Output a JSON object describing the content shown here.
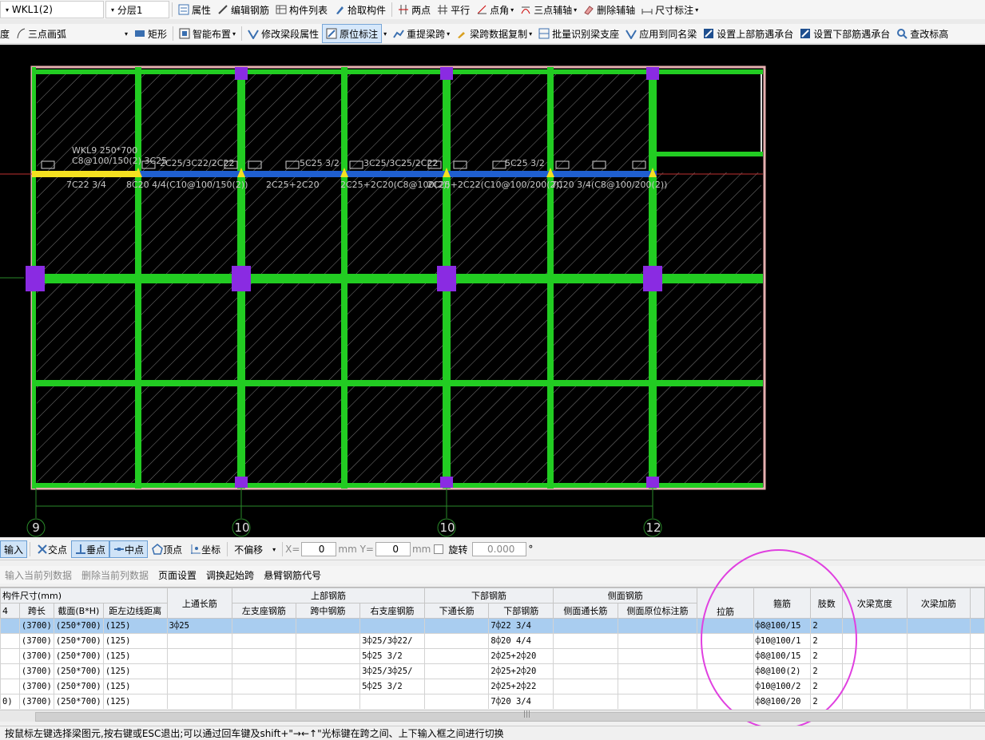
{
  "toolbar1": {
    "component": "WKL1(2)",
    "layer": "分层1",
    "items": [
      "属性",
      "编辑钢筋",
      "构件列表",
      "拾取构件",
      "两点",
      "平行",
      "点角",
      "三点辅轴",
      "删除辅轴",
      "尺寸标注"
    ]
  },
  "toolbar2": {
    "items": [
      "度",
      "三点画弧",
      "矩形",
      "智能布置",
      "修改梁段属性",
      "原位标注",
      "重提梁跨",
      "梁跨数据复制",
      "批量识别梁支座",
      "应用到同名梁",
      "设置上部筋遇承台",
      "设置下部筋遇承台",
      "查改标高"
    ]
  },
  "canvas": {
    "axis_labels": [
      "9",
      "10",
      "10",
      "12"
    ],
    "beam_name": "WKL9 250*700",
    "beam_stirrup": "C8@100/150(2) 3C25",
    "top_labels": [
      "2C25/3C22/2C22",
      "5C25 3/2",
      "3C25/3C25/2C22",
      "5C25 3/2"
    ],
    "bottom_labels": [
      "7C22 3/4",
      "8C20 4/4(C10@100/150(2))",
      "2C25+2C20",
      "2C25+2C20(C8@100(2))",
      "2C25+2C22(C10@100/200(2))",
      "7C20 3/4(C8@100/200(2))"
    ]
  },
  "snapbar": {
    "input_label": "输入",
    "modes": [
      "交点",
      "垂点",
      "中点",
      "顶点",
      "坐标"
    ],
    "offset": "不偏移",
    "x_label": "X=",
    "x_value": "0",
    "y_label": "mm Y=",
    "y_value": "0",
    "unit": "mm",
    "rotate_label": "旋转",
    "rotate_value": "0.000",
    "degree": "°"
  },
  "gridtb": {
    "buttons": [
      "输入当前列数据",
      "删除当前列数据",
      "页面设置",
      "调换起始跨",
      "悬臂钢筋代号"
    ]
  },
  "grid": {
    "group_headers": {
      "size": "构件尺寸(mm)",
      "top_long": "上通长筋",
      "top": "上部钢筋",
      "bottom": "下部钢筋",
      "side": "侧面钢筋",
      "tie": "拉筋",
      "stirrup": "箍筋",
      "legs": "肢数",
      "sec_width": "次梁宽度",
      "sec_add": "次梁加筋"
    },
    "columns": [
      "4",
      "跨长",
      "截面(B*H)",
      "距左边线距离",
      "左支座钢筋",
      "跨中钢筋",
      "右支座钢筋",
      "下通长筋",
      "下部钢筋",
      "侧面通长筋",
      "侧面原位标注筋"
    ],
    "rows": [
      {
        "c0": "",
        "span": "(3700)",
        "section": "(250*700)",
        "dist": "(125)",
        "toplong": "3⌽25",
        "left": "",
        "mid": "",
        "right": "",
        "botlong": "",
        "bottom": "7⌽22 3/4",
        "sidelong": "",
        "sideraw": "",
        "tie": "",
        "stirrup": "⌽8@100/15",
        "legs": "2",
        "secw": "",
        "seca": ""
      },
      {
        "c0": "",
        "span": "(3700)",
        "section": "(250*700)",
        "dist": "(125)",
        "toplong": "",
        "left": "",
        "mid": "",
        "right": "3⌽25/3⌽22/",
        "botlong": "",
        "bottom": "8⌽20 4/4",
        "sidelong": "",
        "sideraw": "",
        "tie": "",
        "stirrup": "⌽10@100/1",
        "legs": "2",
        "secw": "",
        "seca": ""
      },
      {
        "c0": "",
        "span": "(3700)",
        "section": "(250*700)",
        "dist": "(125)",
        "toplong": "",
        "left": "",
        "mid": "",
        "right": "5⌽25 3/2",
        "botlong": "",
        "bottom": "2⌽25+2⌽20",
        "sidelong": "",
        "sideraw": "",
        "tie": "",
        "stirrup": "⌽8@100/15",
        "legs": "2",
        "secw": "",
        "seca": ""
      },
      {
        "c0": "",
        "span": "(3700)",
        "section": "(250*700)",
        "dist": "(125)",
        "toplong": "",
        "left": "",
        "mid": "",
        "right": "3⌽25/3⌽25/",
        "botlong": "",
        "bottom": "2⌽25+2⌽20",
        "sidelong": "",
        "sideraw": "",
        "tie": "",
        "stirrup": "⌽8@100(2)",
        "legs": "2",
        "secw": "",
        "seca": ""
      },
      {
        "c0": "",
        "span": "(3700)",
        "section": "(250*700)",
        "dist": "(125)",
        "toplong": "",
        "left": "",
        "mid": "",
        "right": "5⌽25 3/2",
        "botlong": "",
        "bottom": "2⌽25+2⌽22",
        "sidelong": "",
        "sideraw": "",
        "tie": "",
        "stirrup": "⌽10@100/2",
        "legs": "2",
        "secw": "",
        "seca": ""
      },
      {
        "c0": "0)",
        "span": "(3700)",
        "section": "(250*700)",
        "dist": "(125)",
        "toplong": "",
        "left": "",
        "mid": "",
        "right": "",
        "botlong": "",
        "bottom": "7⌽20 3/4",
        "sidelong": "",
        "sideraw": "",
        "tie": "",
        "stirrup": "⌽8@100/20",
        "legs": "2",
        "secw": "",
        "seca": ""
      }
    ]
  },
  "scroll_grip": "|||",
  "status": "按鼠标左键选择梁图元,按右键或ESC退出;可以通过回车键及shift+\"→←↑\"光标键在跨之间、上下输入框之间进行切换",
  "colors": {
    "beam": "#22cc22",
    "selected_beam": "#1f5fd0",
    "column": "#8a2be2",
    "highlight": "#e040e0",
    "selection_row": "#a9cdf0"
  }
}
